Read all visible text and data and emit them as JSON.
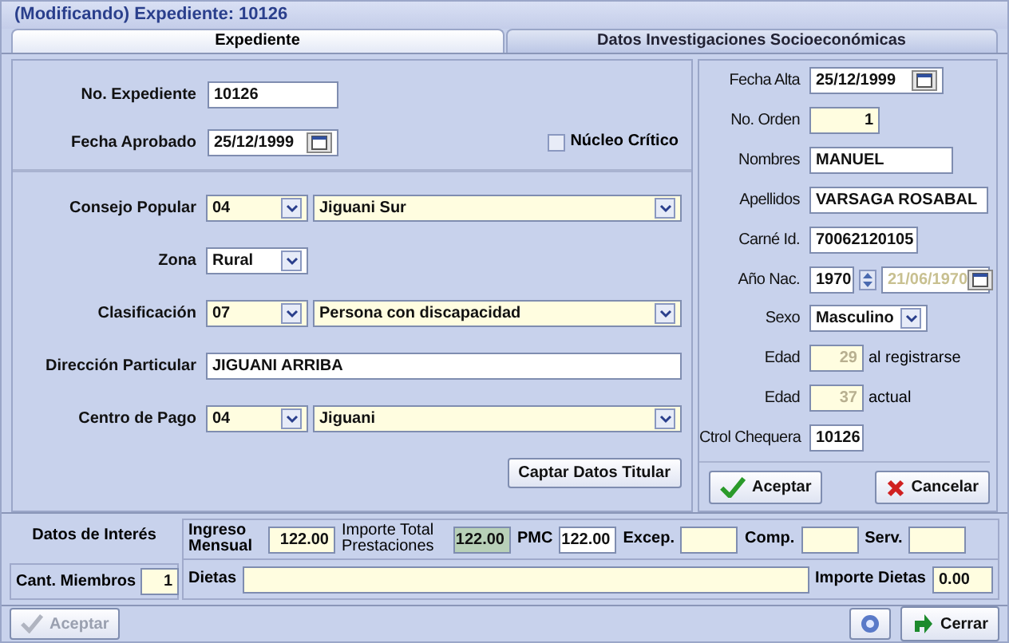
{
  "window": {
    "title": "(Modificando) Expediente: 10126"
  },
  "tabs": [
    {
      "label": "Expediente",
      "selected": true
    },
    {
      "label": "Datos Investigaciones Socioeconómicas",
      "selected": false
    }
  ],
  "header_section": {
    "no_expediente": {
      "label": "No. Expediente",
      "value": "10126"
    },
    "fecha_aprobado": {
      "label": "Fecha Aprobado",
      "value": "25/12/1999"
    },
    "nucleo_critico": {
      "label": "Núcleo Crítico",
      "checked": false
    }
  },
  "location_section": {
    "rows": [
      {
        "kind": "combo_pair",
        "label": "Consejo Popular",
        "code": "04",
        "name": "Jiguani Sur"
      },
      {
        "kind": "combo",
        "label": "Zona",
        "value": "Rural"
      },
      {
        "kind": "combo_pair",
        "label": "Clasificación",
        "code": "07",
        "name": "Persona con discapacidad"
      },
      {
        "kind": "text",
        "label": "Dirección Particular",
        "value": "JIGUANI ARRIBA"
      },
      {
        "kind": "combo_pair",
        "label": "Centro de Pago",
        "code": "04",
        "name": "Jiguani"
      }
    ],
    "button": "Captar Datos Titular"
  },
  "person": {
    "rows": [
      {
        "kind": "date",
        "label": "Fecha Alta",
        "value": "25/12/1999"
      },
      {
        "kind": "number",
        "label": "No. Orden",
        "value": "1"
      },
      {
        "kind": "text",
        "label": "Nombres",
        "value": "MANUEL"
      },
      {
        "kind": "text",
        "label": "Apellidos",
        "value": "VARSAGA ROSABAL"
      },
      {
        "kind": "text",
        "label": "Carné Id.",
        "value": "70062120105"
      },
      {
        "kind": "year",
        "label": "Año Nac.",
        "value": "1970",
        "date": "21/06/1970"
      },
      {
        "kind": "combo",
        "label": "Sexo",
        "value": "Masculino"
      },
      {
        "kind": "readonly",
        "label": "Edad",
        "value": "29",
        "suffix": "al registrarse"
      },
      {
        "kind": "readonly",
        "label": "Edad",
        "value": "37",
        "suffix": "actual"
      },
      {
        "kind": "text",
        "label": "Ctrol Chequera",
        "value": "10126"
      }
    ],
    "buttons": [
      {
        "kind": "accept",
        "label": "Aceptar"
      },
      {
        "kind": "cancel",
        "label": "Cancelar"
      }
    ]
  },
  "interest": {
    "title": "Datos de Interés",
    "members": {
      "label": "Cant. Miembros",
      "value": "1"
    },
    "fields": [
      {
        "kind": "input",
        "label": "Ingreso Mensual",
        "value": "122.00"
      },
      {
        "kind": "total",
        "label": "Importe Total Prestaciones",
        "value": "122.00"
      },
      {
        "kind": "plain",
        "label": "PMC",
        "value": "122.00"
      },
      {
        "kind": "input",
        "label": "Excep."
      },
      {
        "kind": "input",
        "label": "Comp."
      },
      {
        "kind": "input",
        "label": "Serv."
      }
    ],
    "dietas": {
      "label": "Dietas"
    },
    "importe_dietas": {
      "label": "Importe Dietas",
      "value": "0.00"
    }
  },
  "footer": {
    "accept": {
      "label": "Aceptar",
      "disabled": true
    },
    "close": {
      "label": "Cerrar"
    }
  }
}
